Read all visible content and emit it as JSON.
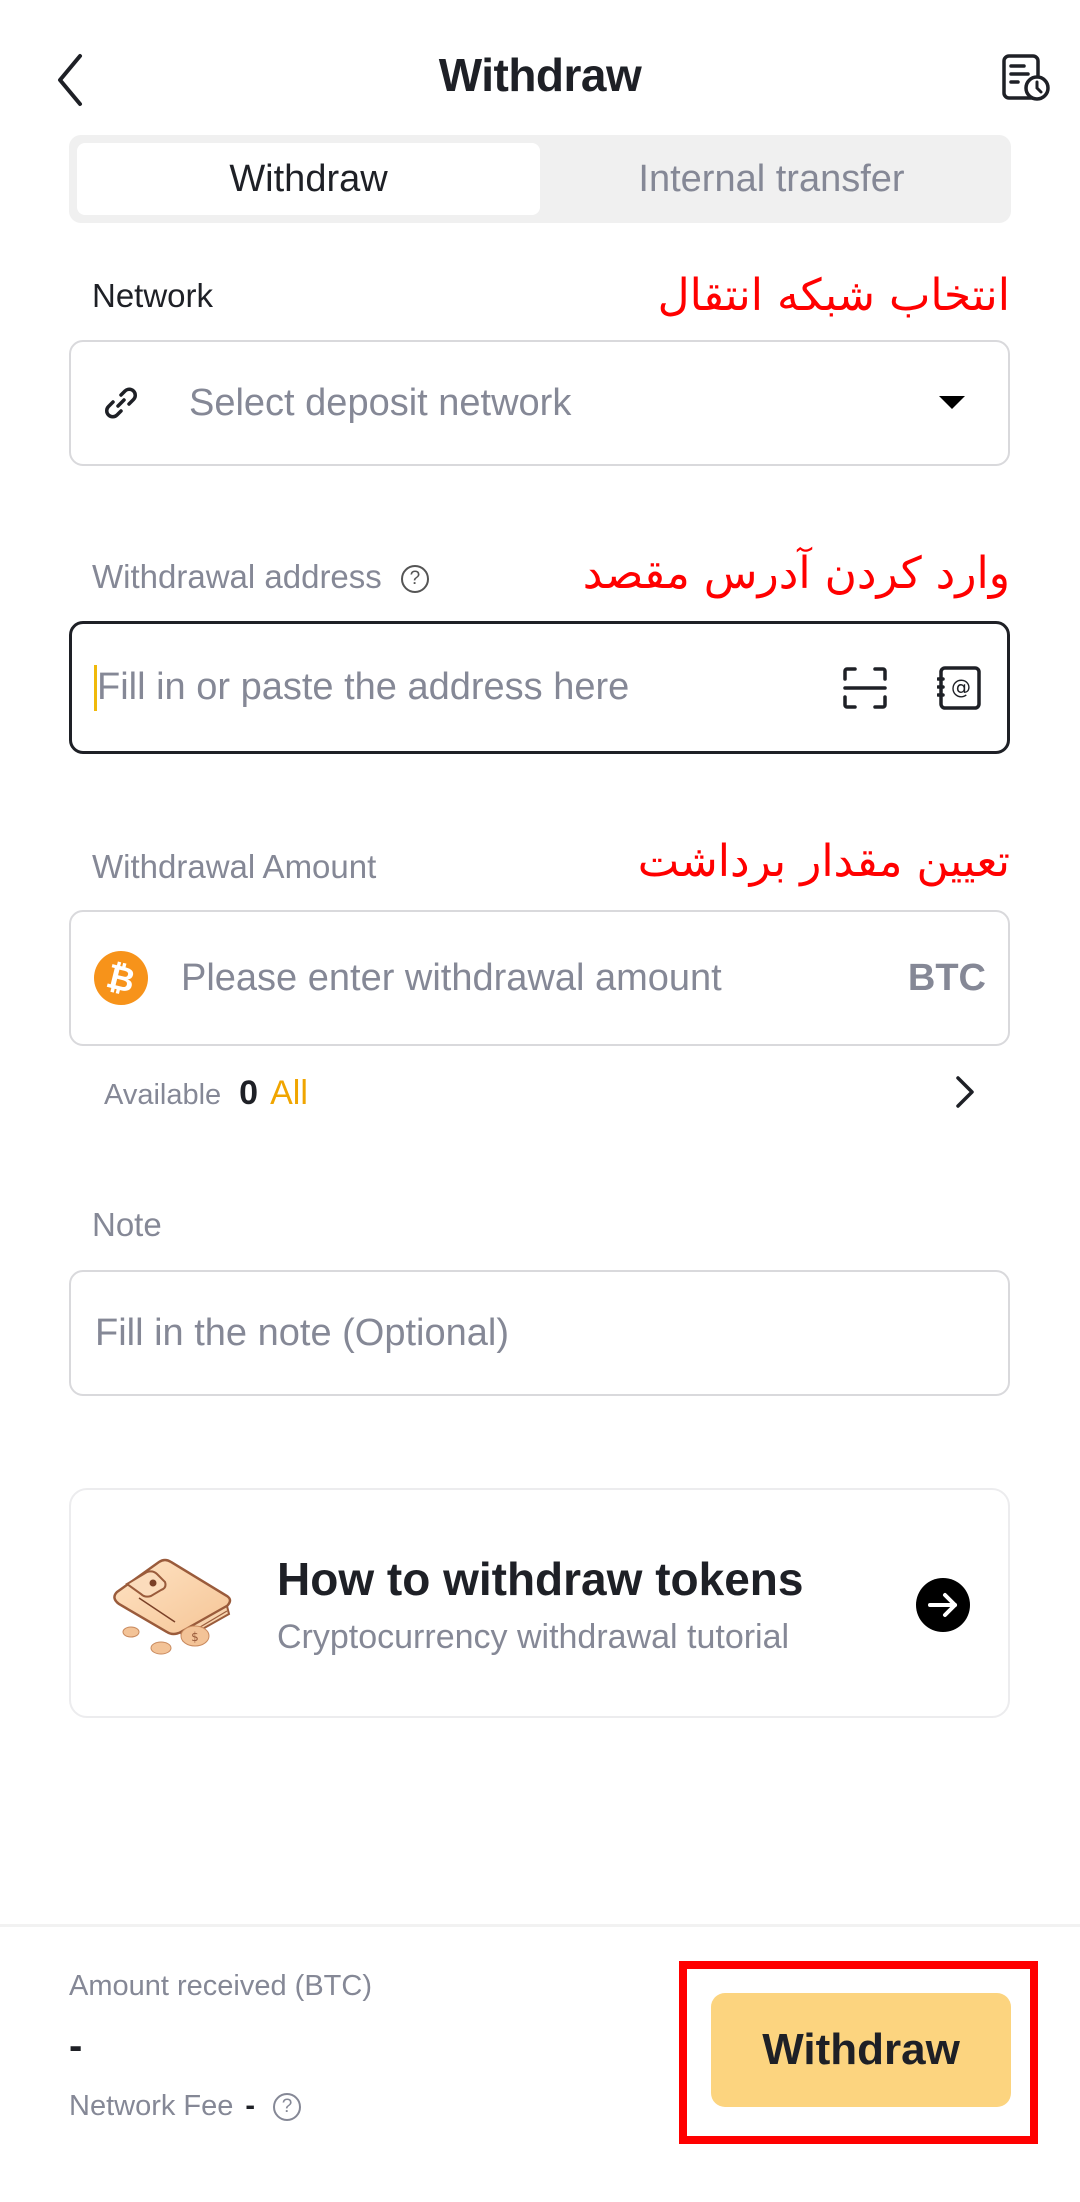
{
  "header": {
    "title": "Withdraw",
    "back_icon": "chevron-left-icon",
    "history_icon": "document-clock-icon"
  },
  "tabs": [
    {
      "label": "Withdraw",
      "active": true
    },
    {
      "label": "Internal transfer",
      "active": false
    }
  ],
  "network": {
    "label": "Network",
    "annotation": "انتخاب شبکه انتقال",
    "icon": "link-icon",
    "placeholder": "Select deposit network",
    "dropdown_icon": "caret-down-icon"
  },
  "address": {
    "label": "Withdrawal address",
    "annotation": "وارد کردن آدرس مقصد",
    "help_icon": "question-circle-icon",
    "placeholder": "Fill in or paste the address here",
    "value": "",
    "scan_icon": "scan-icon",
    "address_book_icon": "address-book-icon"
  },
  "amount": {
    "label": "Withdrawal Amount",
    "annotation": "تعیین مقدار برداشت",
    "coin_icon": "bitcoin-icon",
    "placeholder": "Please enter withdrawal amount",
    "value": "",
    "unit": "BTC",
    "available_label": "Available",
    "available_value": "0",
    "all_label": "All",
    "chevron_icon": "chevron-right-icon"
  },
  "note": {
    "label": "Note",
    "placeholder": "Fill in the note (Optional)",
    "value": ""
  },
  "tutorial_card": {
    "title": "How to withdraw tokens",
    "subtitle": "Cryptocurrency withdrawal tutorial",
    "illustration": "wallet-coins-illustration",
    "arrow_icon": "arrow-right-circle-icon"
  },
  "footer": {
    "received_label": "Amount received (BTC)",
    "received_value": "-",
    "fee_label": "Network Fee",
    "fee_value": "-",
    "help_icon": "question-circle-icon",
    "withdraw_button": "Withdraw"
  },
  "colors": {
    "accent_yellow": "#fcd47f",
    "link_yellow": "#f0a500",
    "annotation_red": "#ff0000",
    "bitcoin_orange": "#f7931a",
    "text_primary": "#1e2026",
    "text_secondary": "#858896"
  }
}
